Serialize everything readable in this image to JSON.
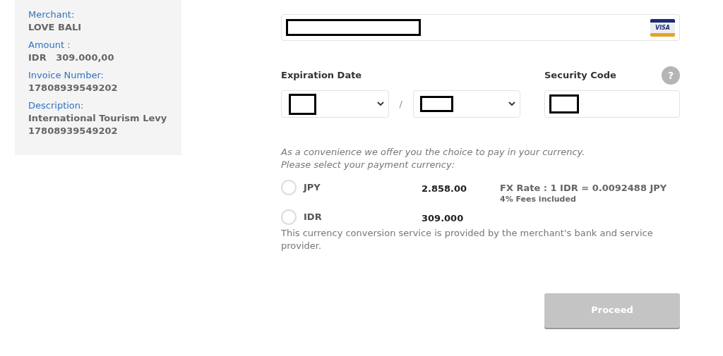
{
  "summary": [
    {
      "label": "Merchant:",
      "value": "LOVE BALI"
    },
    {
      "label": "Amount :",
      "value": "IDR   309.000,00"
    },
    {
      "label": "Invoice Number:",
      "value": "17808939549202"
    },
    {
      "label": "Description:",
      "value": "International Tourism Levy\n17808939549202"
    }
  ],
  "card_brand": "VISA",
  "expiration": {
    "label": "Expiration Date",
    "separator": "/"
  },
  "security": {
    "label": "Security Code",
    "help": "?"
  },
  "notice": "As a convenience we offer you the choice to pay in your currency.\nPlease select your payment currency:",
  "currencies": [
    {
      "code": "JPY",
      "amount": "2.858.00",
      "rate": "FX Rate : 1 IDR = 0.0092488 JPY",
      "fees": "4% Fees included",
      "selected": false
    },
    {
      "code": "IDR",
      "amount": "309.000",
      "selected": false
    }
  ],
  "disclaimer": "This currency conversion service is provided by the merchant's bank and service provider.",
  "proceed": {
    "label": "Proceed",
    "disabled": true
  }
}
